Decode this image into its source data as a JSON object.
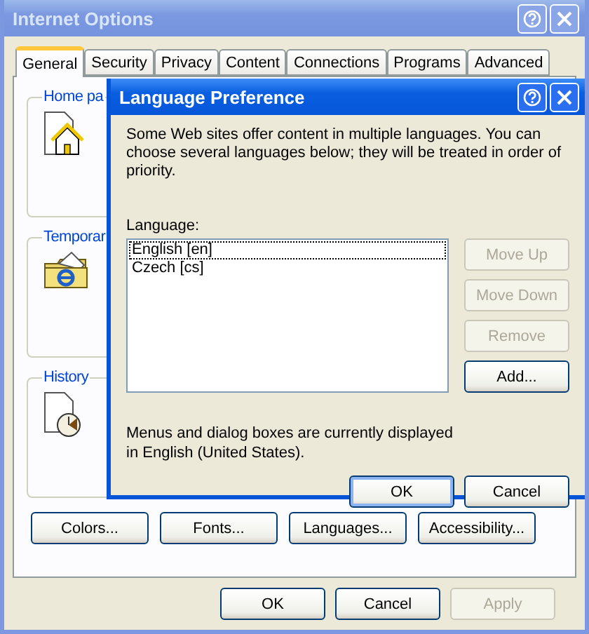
{
  "window": {
    "title": "Internet Options"
  },
  "tabs": [
    {
      "label": "General",
      "selected": true
    },
    {
      "label": "Security",
      "selected": false
    },
    {
      "label": "Privacy",
      "selected": false
    },
    {
      "label": "Content",
      "selected": false
    },
    {
      "label": "Connections",
      "selected": false
    },
    {
      "label": "Programs",
      "selected": false
    },
    {
      "label": "Advanced",
      "selected": false
    }
  ],
  "groups": [
    {
      "label": "Home pa",
      "kind": "house"
    },
    {
      "label": "Temporar",
      "kind": "folder"
    },
    {
      "label": "History",
      "kind": "clock"
    }
  ],
  "panel_buttons": [
    {
      "label": "Colors..."
    },
    {
      "label": "Fonts..."
    },
    {
      "label": "Languages..."
    },
    {
      "label": "Accessibility..."
    }
  ],
  "footer_buttons": [
    {
      "label": "OK",
      "disabled": false
    },
    {
      "label": "Cancel",
      "disabled": false
    },
    {
      "label": "Apply",
      "disabled": true
    }
  ],
  "dialog": {
    "title": "Language Preference",
    "description": "Some Web sites offer content in multiple languages. You can choose several languages below; they will be treated in order of priority.",
    "list_label": "Language:",
    "languages": [
      {
        "label": "English [en]",
        "focused": true
      },
      {
        "label": "Czech [cs]",
        "focused": false
      }
    ],
    "side_buttons": [
      {
        "label": "Move Up",
        "disabled": true
      },
      {
        "label": "Move Down",
        "disabled": true
      },
      {
        "label": "Remove",
        "disabled": true
      },
      {
        "label": "Add...",
        "disabled": false
      }
    ],
    "note": "Menus and dialog boxes are currently displayed in English (United States).",
    "buttons": [
      {
        "label": "OK",
        "default": true
      },
      {
        "label": "Cancel",
        "default": false
      }
    ]
  }
}
